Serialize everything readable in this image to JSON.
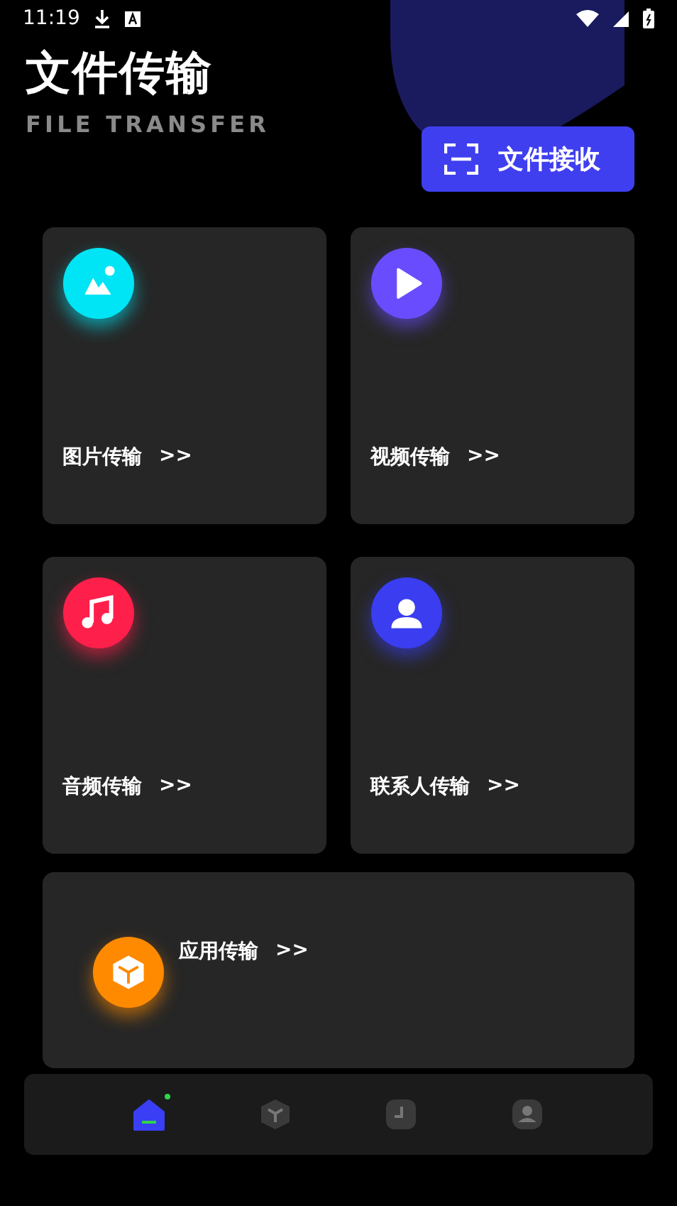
{
  "status_bar": {
    "time": "11:19"
  },
  "header": {
    "title": "文件传输",
    "subtitle": "FILE TRANSFER",
    "receive_button": "文件接收"
  },
  "cards": [
    {
      "kind": "image",
      "label": "图片传输",
      "arrow": ">>",
      "color": "#00e5f5"
    },
    {
      "kind": "video",
      "label": "视频传输",
      "arrow": ">>",
      "color": "#6a4cff"
    },
    {
      "kind": "music",
      "label": "音频传输",
      "arrow": ">>",
      "color": "#ff1f4b"
    },
    {
      "kind": "contact",
      "label": "联系人传输",
      "arrow": ">>",
      "color": "#3a3ef0"
    },
    {
      "kind": "app",
      "label": "应用传输",
      "arrow": ">>",
      "color": "#ff8a00"
    }
  ],
  "bottom_nav": [
    {
      "kind": "home",
      "selected": true
    },
    {
      "kind": "cube",
      "selected": false
    },
    {
      "kind": "clock",
      "selected": false
    },
    {
      "kind": "person",
      "selected": false
    }
  ]
}
